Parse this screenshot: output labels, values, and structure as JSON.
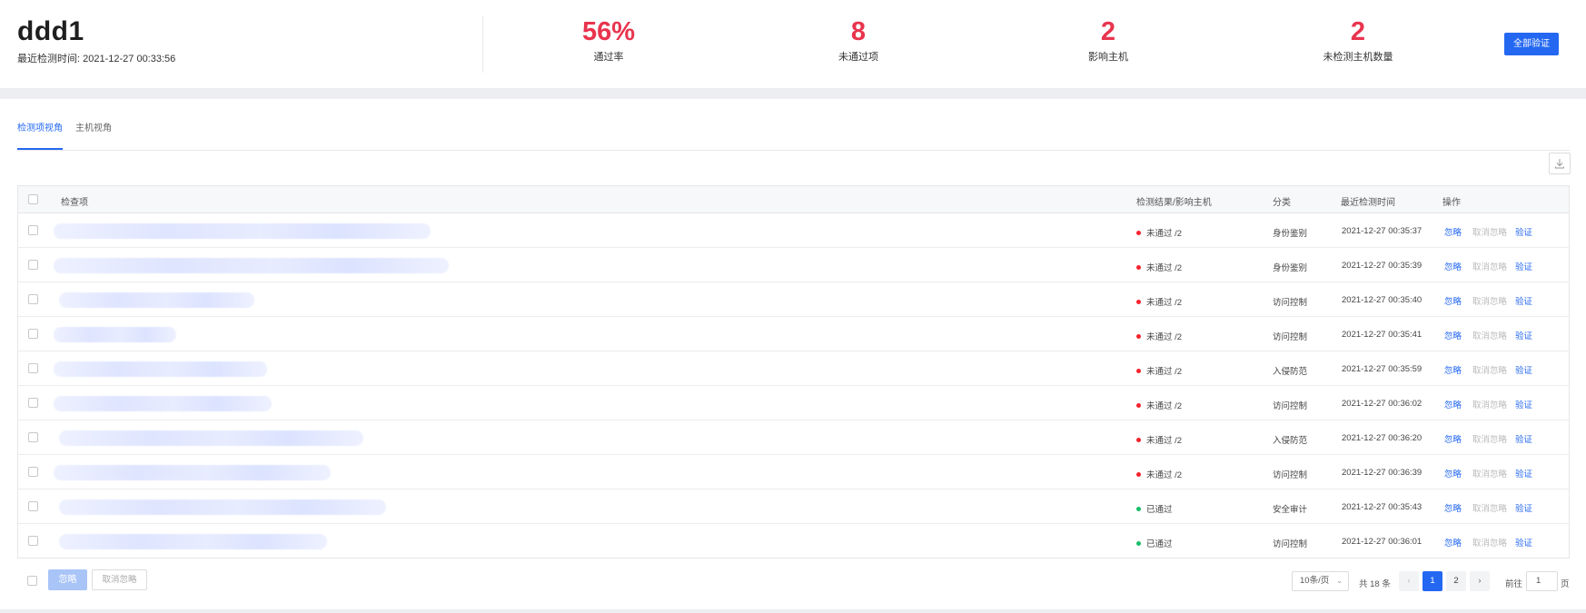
{
  "summary": {
    "host_name": "ddd1",
    "last_check_label": "最近检测时间:",
    "last_check_time": "2021-12-27 00:33:56",
    "stats": [
      {
        "value": "56%",
        "label": "通过率"
      },
      {
        "value": "8",
        "label": "未通过项"
      },
      {
        "value": "2",
        "label": "影响主机"
      },
      {
        "value": "2",
        "label": "未检测主机数量"
      }
    ],
    "verify_all_label": "全部验证",
    "accent_color": "#e8344e",
    "primary_color": "#2468f2"
  },
  "tabs": [
    {
      "label": "检测项视角",
      "active": true
    },
    {
      "label": "主机视角",
      "active": false
    }
  ],
  "toolbar": {
    "download_icon": "download-icon"
  },
  "table": {
    "headers": {
      "item": "检查项",
      "result": "检测结果/影响主机",
      "category": "分类",
      "last_check": "最近检测时间",
      "actions": "操作"
    },
    "rows": [
      {
        "result": "未通过 /2",
        "status": "fail",
        "category": "身份鉴别",
        "time": "2021-12-27 00:35:37"
      },
      {
        "result": "未通过 /2",
        "status": "fail",
        "category": "身份鉴别",
        "time": "2021-12-27 00:35:39"
      },
      {
        "result": "未通过 /2",
        "status": "fail",
        "category": "访问控制",
        "time": "2021-12-27 00:35:40"
      },
      {
        "result": "未通过 /2",
        "status": "fail",
        "category": "访问控制",
        "time": "2021-12-27 00:35:41"
      },
      {
        "result": "未通过 /2",
        "status": "fail",
        "category": "入侵防范",
        "time": "2021-12-27 00:35:59"
      },
      {
        "result": "未通过 /2",
        "status": "fail",
        "category": "访问控制",
        "time": "2021-12-27 00:36:02"
      },
      {
        "result": "未通过 /2",
        "status": "fail",
        "category": "入侵防范",
        "time": "2021-12-27 00:36:20"
      },
      {
        "result": "未通过 /2",
        "status": "fail",
        "category": "访问控制",
        "time": "2021-12-27 00:36:39"
      },
      {
        "result": "已通过",
        "status": "pass",
        "category": "安全审计",
        "time": "2021-12-27 00:35:43"
      },
      {
        "result": "已通过",
        "status": "pass",
        "category": "访问控制",
        "time": "2021-12-27 00:36:01"
      }
    ],
    "actions": {
      "ignore": "忽略",
      "cancel_ignore": "取消忽略",
      "verify": "验证"
    },
    "status_colors": {
      "fail": "#f5222d",
      "pass": "#19be6b"
    }
  },
  "footer": {
    "ignore_label": "忽略",
    "cancel_ignore_label": "取消忽略",
    "page_size": "10条/页",
    "total": "共 18 条",
    "pages": [
      "1",
      "2"
    ],
    "current_page": "1",
    "goto_label": "前往",
    "goto_value": "1",
    "goto_unit": "页"
  }
}
